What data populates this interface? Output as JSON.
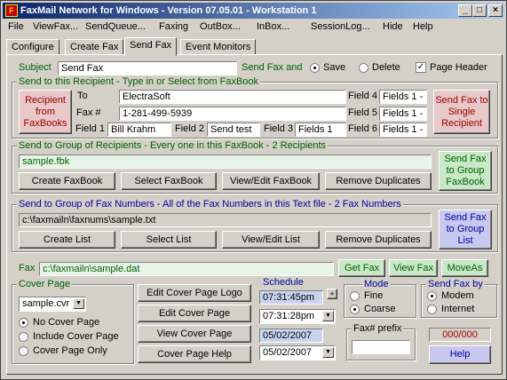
{
  "window": {
    "title": "FaxMail Network for Windows - Version 07.05.01 - Workstation 1"
  },
  "menu": [
    "File",
    "ViewFax...",
    "SendQueue...",
    "Faxing",
    "OutBox...",
    "InBox...",
    "SessionLog...",
    "Hide",
    "Help"
  ],
  "tabs": [
    "Configure",
    "Create Fax",
    "Send Fax",
    "Event Monitors"
  ],
  "subject": {
    "label": "Subject",
    "value": "Send Fax"
  },
  "send_fax_and": {
    "label": "Send Fax and",
    "save": "Save",
    "delete": "Delete",
    "page_header": "Page Header"
  },
  "recipient": {
    "group_title": "Send to this Recipient - Type in or Select from FaxBook",
    "faxbooks_button": "Recipient from FaxBooks",
    "to_label": "To",
    "to_value": "ElectraSoft",
    "fax_label": "Fax #",
    "fax_value": "1-281-499-5939",
    "field1_label": "Field 1",
    "field1_value": "Bill Krahm",
    "field2_label": "Field 2",
    "field2_value": "Send test",
    "field3_label": "Field 3",
    "field3_value": "Fields 1",
    "field4_label": "Field 4",
    "field4_value": "Fields 1 -",
    "field5_label": "Field 5",
    "field5_value": "Fields 1 -",
    "field6_label": "Field 6",
    "field6_value": "Fields 1 -",
    "send_button": "Send Fax to Single Recipient"
  },
  "group_faxbook": {
    "group_title": "Send to Group of Recipients - Every one in this FaxBook - 2 Recipients",
    "file": "sample.fbk",
    "buttons": [
      "Create FaxBook",
      "Select FaxBook",
      "View/Edit FaxBook",
      "Remove Duplicates"
    ],
    "send_button": "Send Fax to Group FaxBook"
  },
  "group_faxnums": {
    "group_title": "Send to Group of Fax Numbers - All of the Fax Numbers in this Text file - 2 Fax Numbers",
    "file": "c:\\faxmailn\\faxnums\\sample.txt",
    "buttons": [
      "Create List",
      "Select List",
      "View/Edit List",
      "Remove Duplicates"
    ],
    "send_button": "Send Fax to Group List"
  },
  "fax_file": {
    "label": "Fax",
    "value": "c:\\faxmailn\\sample.dat",
    "get_fax": "Get Fax",
    "view_fax": "View Fax",
    "move_as": "MoveAs"
  },
  "cover_page": {
    "group_title": "Cover Page",
    "file": "sample.cvr",
    "options": [
      "No Cover Page",
      "Include Cover Page",
      "Cover Page Only"
    ],
    "selected": 0,
    "buttons": [
      "Edit Cover Page Logo",
      "Edit Cover Page",
      "View Cover Page",
      "Cover Page Help"
    ]
  },
  "schedule": {
    "title": "Schedule",
    "time1": "07:31:45pm",
    "time2": "07:31:28pm",
    "date1": "05/02/2007",
    "date2": "05/02/2007"
  },
  "mode": {
    "title": "Mode",
    "fine": "Fine",
    "coarse": "Coarse",
    "selected": "coarse"
  },
  "send_by": {
    "title": "Send Fax by",
    "modem": "Modem",
    "internet": "Internet",
    "selected": "modem"
  },
  "fax_prefix": {
    "label": "Fax# prefix",
    "value": ""
  },
  "counter": "000/000",
  "help_button": "Help",
  "colors": {
    "title_start": "#0a246a",
    "title_end": "#a6caf0",
    "face": "#d4d0c8"
  }
}
